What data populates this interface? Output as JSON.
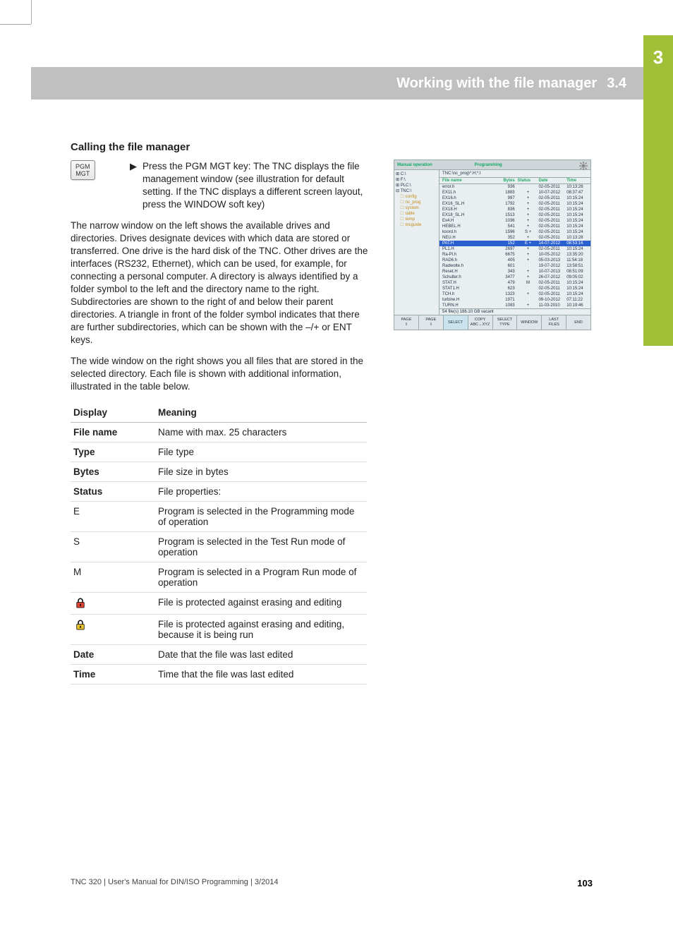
{
  "sideTab": {
    "chapter": "3"
  },
  "header": {
    "title": "Working with the file manager",
    "section": "3.4"
  },
  "section_heading": "Calling the file manager",
  "keycap": {
    "line1": "PGM",
    "line2": "MGT"
  },
  "bullet_arrow": "▶",
  "intro_bullet": "Press the PGM MGT key: The TNC displays the file management window (see illustration for default setting. If the TNC displays a different screen layout, press the WINDOW soft key)",
  "para1": "The narrow window on the left shows the available drives and directories. Drives designate devices with which data are stored or transferred. One drive is the hard disk of the TNC. Other drives are the interfaces (RS232, Ethernet), which can be used, for example, for connecting a personal computer. A directory is always identified by a folder symbol to the left and the directory name to the right. Subdirectories are shown to the right of and below their parent directories. A triangle in front of the folder symbol indicates that there are further subdirectories, which can be shown with the –/+ or ENT keys.",
  "para2": "The wide window on the right shows you all files that are stored in the selected directory. Each file is shown with additional information, illustrated in the table below.",
  "table": {
    "head": {
      "c1": "Display",
      "c2": "Meaning"
    },
    "rows": [
      {
        "k": "File name",
        "v": "Name with max. 25 characters",
        "bold": true
      },
      {
        "k": "Type",
        "v": "File type",
        "bold": true
      },
      {
        "k": "Bytes",
        "v": "File size in bytes",
        "bold": true
      },
      {
        "k": "Status",
        "v": "File properties:",
        "bold": true
      },
      {
        "k": "E",
        "v": "Program is selected in the Programming mode of operation",
        "bold": false
      },
      {
        "k": "S",
        "v": "Program is selected in the Test Run mode of operation",
        "bold": false
      },
      {
        "k": "M",
        "v": "Program is selected in a Program Run mode of operation",
        "bold": false
      },
      {
        "icon": "lock-red",
        "v": "File is protected against erasing and editing"
      },
      {
        "icon": "lock-yellow",
        "v": "File is protected against erasing and editing, because it is being run"
      },
      {
        "k": "Date",
        "v": "Date that the file was last edited",
        "bold": true
      },
      {
        "k": "Time",
        "v": "Time that the file was last edited",
        "bold": true
      }
    ]
  },
  "screenshot": {
    "titlebar": {
      "left": "Manual operation",
      "right": "Programming",
      "sub": "Programming"
    },
    "drives": [
      "⊞ C:\\",
      "⊞ F:\\",
      "⊞ PLC:\\",
      "⊟ TNC:\\"
    ],
    "folders": [
      "config",
      "nc_prog",
      "system",
      "table",
      "temp",
      "tncguide"
    ],
    "path": "TNC:\\nc_prog\\*.H;*.I",
    "columns": [
      "File name",
      "Bytes",
      "Status",
      "Date",
      "Time"
    ],
    "files": [
      {
        "n": "error.h",
        "b": "936",
        "s": "",
        "d": "02-05-2011",
        "t": "10:13:28"
      },
      {
        "n": "EX11.h",
        "b": "1883",
        "s": "+",
        "d": "10-07-2012",
        "t": "08:37:47"
      },
      {
        "n": "EX16.h",
        "b": "997",
        "s": "+",
        "d": "02-05-2011",
        "t": "10:15:24"
      },
      {
        "n": "EX16_SL.H",
        "b": "1792",
        "s": "+",
        "d": "02-05-2011",
        "t": "10:15:24"
      },
      {
        "n": "EX18.H",
        "b": "836",
        "s": "+",
        "d": "02-05-2011",
        "t": "10:15:24"
      },
      {
        "n": "EX18_SL.H",
        "b": "1513",
        "s": "+",
        "d": "02-05-2011",
        "t": "10:15:24"
      },
      {
        "n": "Ex4.H",
        "b": "1036",
        "s": "+",
        "d": "02-05-2011",
        "t": "10:15:24"
      },
      {
        "n": "HEBEL.H",
        "b": "541",
        "s": "+",
        "d": "02-05-2011",
        "t": "10:15:24"
      },
      {
        "n": "koord.h",
        "b": "1596",
        "s": "S +",
        "d": "02-05-2011",
        "t": "10:15:24"
      },
      {
        "n": "NEU.H",
        "b": "352",
        "s": "+",
        "d": "02-05-2011",
        "t": "10:13:28"
      },
      {
        "n": "PAT.H",
        "b": "152",
        "s": "E +",
        "d": "14-07-2012",
        "t": "08:53:16",
        "sel": true
      },
      {
        "n": "PL1.H",
        "b": "2697",
        "s": "+",
        "d": "02-05-2011",
        "t": "10:15:24"
      },
      {
        "n": "Ra-Pl.h",
        "b": "6675",
        "s": "+",
        "d": "10-05-2012",
        "t": "13:35:20"
      },
      {
        "n": "RAD6.h",
        "b": "405",
        "s": "+",
        "d": "05-03-2013",
        "t": "11:54:18"
      },
      {
        "n": "Radwolte.h",
        "b": "601",
        "s": "",
        "d": "19-07-2012",
        "t": "13:58:51"
      },
      {
        "n": "Reset.H",
        "b": "343",
        "s": "+",
        "d": "10-07-2013",
        "t": "08:51:09"
      },
      {
        "n": "Schulter.h",
        "b": "3477",
        "s": "+",
        "d": "26-07-2012",
        "t": "09:05:02"
      },
      {
        "n": "STAT.H",
        "b": "479",
        "s": "M",
        "d": "02-05-2011",
        "t": "10:15:24"
      },
      {
        "n": "STAT1.H",
        "b": "623",
        "s": "",
        "d": "02-05-2011",
        "t": "10:15:24"
      },
      {
        "n": "TCH.h",
        "b": "1323",
        "s": "+",
        "d": "02-05-2011",
        "t": "10:15:24"
      },
      {
        "n": "turbine.H",
        "b": "1971",
        "s": "",
        "d": "09-10-2012",
        "t": "07:11:22"
      },
      {
        "n": "TURN.H",
        "b": "1083",
        "s": "+",
        "d": "11-03-2010",
        "t": "10:19:46"
      }
    ],
    "statusline": "54  file(s) 186.10 GB vacant",
    "softkeys": [
      "PAGE\n⇧",
      "PAGE\n⇩",
      "SELECT",
      "COPY\nABC→XYZ",
      "SELECT\nTYPE",
      "WINDOW",
      "LAST\nFILES",
      "END"
    ]
  },
  "footer": {
    "left": "TNC 320 | User's Manual for DIN/ISO Programming | 3/2014",
    "page": "103"
  }
}
